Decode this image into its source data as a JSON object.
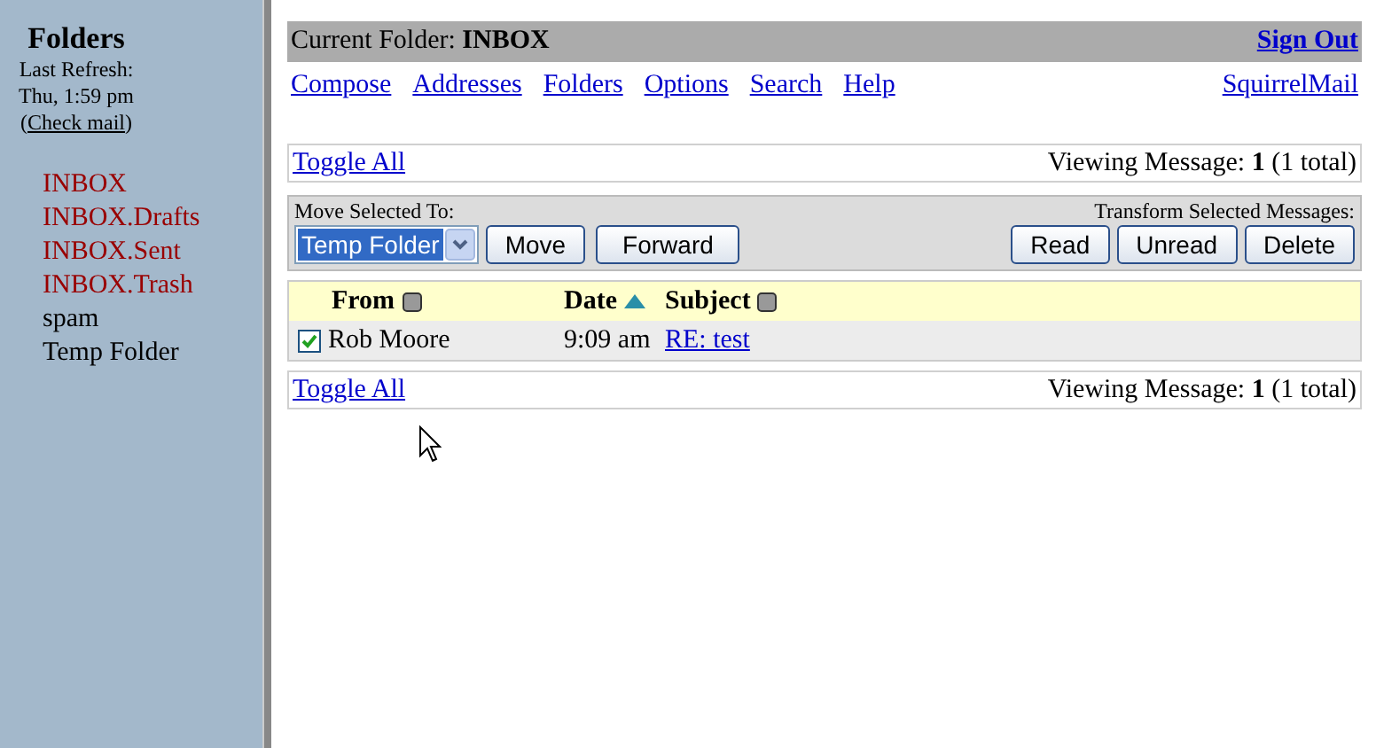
{
  "sidebar": {
    "title": "Folders",
    "refresh_label": "Last Refresh:",
    "refresh_time": "Thu, 1:59 pm",
    "check_mail_open": "(",
    "check_mail": "Check mail",
    "check_mail_close": ")",
    "folders": [
      {
        "name": "INBOX",
        "color": "#990000"
      },
      {
        "name": "INBOX.Drafts",
        "color": "#990000"
      },
      {
        "name": "INBOX.Sent",
        "color": "#990000"
      },
      {
        "name": "INBOX.Trash",
        "color": "#990000"
      },
      {
        "name": "spam",
        "color": "#000000"
      },
      {
        "name": "Temp Folder",
        "color": "#000000"
      }
    ]
  },
  "header": {
    "label": "Current Folder:",
    "folder": "INBOX",
    "sign_out": "Sign Out"
  },
  "nav": {
    "links": [
      "Compose",
      "Addresses",
      "Folders",
      "Options",
      "Search",
      "Help"
    ],
    "brand": "SquirrelMail"
  },
  "top_bar": {
    "toggle": "Toggle All",
    "viewing": "Viewing Message: **1** (1 total)"
  },
  "actions": {
    "move_label": "Move Selected To:",
    "folder_select": "Temp Folder",
    "move": "Move",
    "forward": "Forward",
    "transform_label": "Transform Selected Messages:",
    "buttons": [
      "Read",
      "Unread",
      "Delete"
    ]
  },
  "table": {
    "columns": [
      {
        "label": "From",
        "kind": "unsorted"
      },
      {
        "label": "Date",
        "kind": "ascending"
      },
      {
        "label": "Subject",
        "kind": "unsorted"
      }
    ],
    "rows": [
      {
        "checked": true,
        "from": "Rob Moore",
        "date": "9:09 am",
        "subject": "RE: test"
      }
    ]
  },
  "bottom_bar": {
    "toggle": "Toggle All",
    "viewing": "Viewing Message: **1** (1 total)"
  }
}
